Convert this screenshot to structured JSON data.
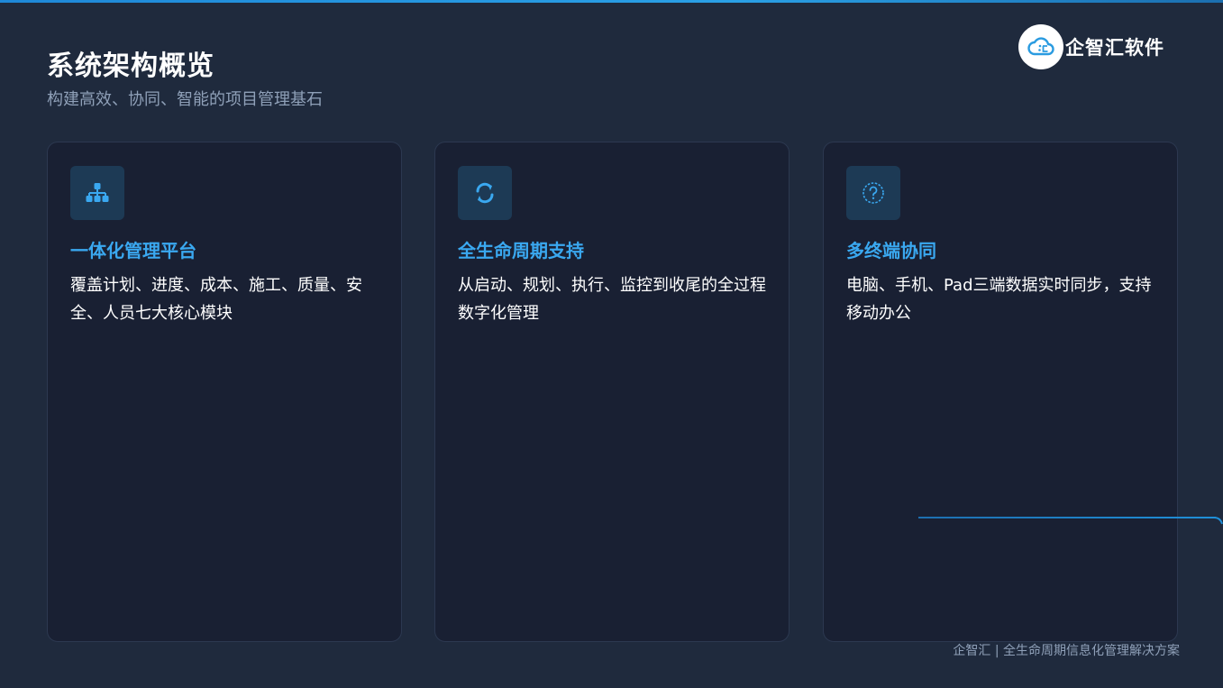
{
  "header": {
    "title": "系统架构概览",
    "subtitle": "构建高效、协同、智能的项目管理基石"
  },
  "logo": {
    "text": "企智汇软件",
    "icon": "cloud-logo-icon"
  },
  "colors": {
    "background": "#1f2a3d",
    "card_background": "#192033",
    "accent": "#3aa8f0",
    "icon_tile": "#1d3a55",
    "muted_text": "#8fa0b8"
  },
  "cards": [
    {
      "icon": "hierarchy-icon",
      "title": "一体化管理平台",
      "description": "覆盖计划、进度、成本、施工、质量、安全、人员七大核心模块"
    },
    {
      "icon": "cycle-arrows-icon",
      "title": "全生命周期支持",
      "description": "从启动、规划、执行、监控到收尾的全过程数字化管理"
    },
    {
      "icon": "question-circle-icon",
      "title": "多终端协同",
      "description": "电脑、手机、Pad三端数据实时同步，支持移动办公"
    }
  ],
  "footer": {
    "text": "企智汇 | 全生命周期信息化管理解决方案"
  }
}
